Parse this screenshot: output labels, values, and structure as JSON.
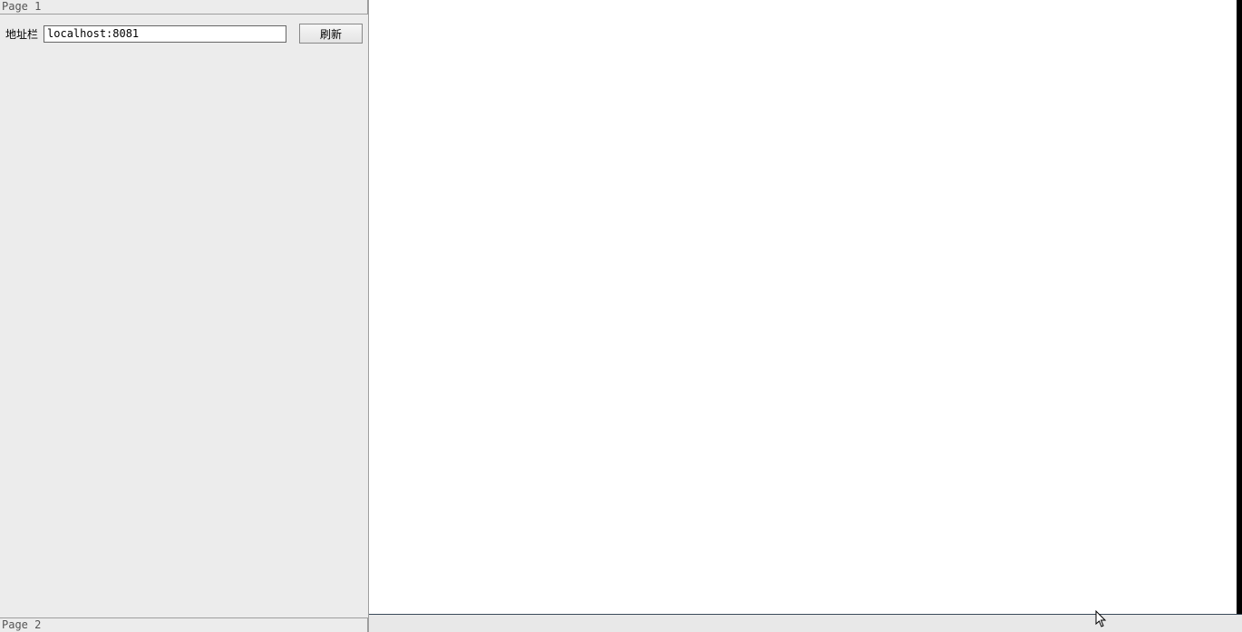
{
  "leftPanel": {
    "topSection": {
      "title": "Page 1"
    },
    "addressBar": {
      "label": "地址栏",
      "value": "localhost:8081"
    },
    "refreshButton": {
      "label": "刷新"
    },
    "bottomSection": {
      "title": "Page 2"
    }
  }
}
